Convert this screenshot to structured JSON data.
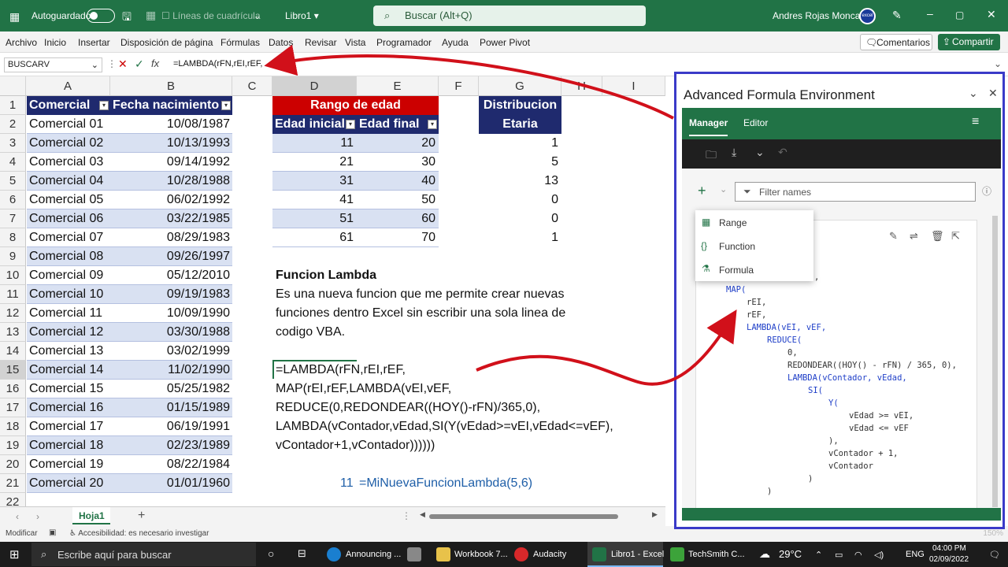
{
  "titlebar": {
    "autosave_label": "Autoguardado",
    "gridlines_label": "Líneas de cuadrícula",
    "filename": "Libro1",
    "search_placeholder": "Buscar (Alt+Q)",
    "user_name": "Andres Rojas Moncada",
    "avatar_text": "excel"
  },
  "menu": {
    "items": [
      "Archivo",
      "Inicio",
      "Insertar",
      "Disposición de página",
      "Fórmulas",
      "Datos",
      "Revisar",
      "Vista",
      "Programador",
      "Ayuda",
      "Power Pivot"
    ],
    "comments": "Comentarios",
    "share": "Compartir"
  },
  "formula_bar": {
    "name_box": "BUSCARV",
    "fx": "fx",
    "formula": "=LAMBDA(rFN,rEI,rEF,"
  },
  "grid": {
    "columns": [
      "A",
      "B",
      "C",
      "D",
      "E",
      "F",
      "G",
      "H",
      "I"
    ],
    "rows": [
      "1",
      "2",
      "3",
      "4",
      "5",
      "6",
      "7",
      "8",
      "9",
      "10",
      "11",
      "12",
      "13",
      "14",
      "15",
      "16",
      "17",
      "18",
      "19",
      "20",
      "21",
      "22"
    ],
    "table1_headers": [
      "Comercial",
      "Fecha nacimiento"
    ],
    "table1": [
      [
        "Comercial 01",
        "10/08/1987"
      ],
      [
        "Comercial 02",
        "10/13/1993"
      ],
      [
        "Comercial 03",
        "09/14/1992"
      ],
      [
        "Comercial 04",
        "10/28/1988"
      ],
      [
        "Comercial 05",
        "06/02/1992"
      ],
      [
        "Comercial 06",
        "03/22/1985"
      ],
      [
        "Comercial 07",
        "08/29/1983"
      ],
      [
        "Comercial 08",
        "09/26/1997"
      ],
      [
        "Comercial 09",
        "05/12/2010"
      ],
      [
        "Comercial 10",
        "09/19/1983"
      ],
      [
        "Comercial 11",
        "10/09/1990"
      ],
      [
        "Comercial 12",
        "03/30/1988"
      ],
      [
        "Comercial 13",
        "03/02/1999"
      ],
      [
        "Comercial 14",
        "11/02/1990"
      ],
      [
        "Comercial 15",
        "05/25/1982"
      ],
      [
        "Comercial 16",
        "01/15/1989"
      ],
      [
        "Comercial 17",
        "06/19/1991"
      ],
      [
        "Comercial 18",
        "02/23/1989"
      ],
      [
        "Comercial 19",
        "08/22/1984"
      ],
      [
        "Comercial 20",
        "01/01/1960"
      ]
    ],
    "range_title": "Rango de edad",
    "range_headers": [
      "Edad inicial",
      "Edad final"
    ],
    "ranges": [
      [
        "11",
        "20"
      ],
      [
        "21",
        "30"
      ],
      [
        "31",
        "40"
      ],
      [
        "41",
        "50"
      ],
      [
        "51",
        "60"
      ],
      [
        "61",
        "70"
      ]
    ],
    "dist_title_1": "Distribucion",
    "dist_title_2": "Etaria",
    "dist_values": [
      "1",
      "5",
      "13",
      "0",
      "0",
      "1"
    ],
    "lambda_title": "Funcion Lambda",
    "lambda_desc": [
      "Es una nueva funcion que me permite crear nuevas",
      "funciones dentro Excel sin escribir una sola linea de",
      "codigo VBA."
    ],
    "formula_lines": [
      "=LAMBDA(rFN,rEI,rEF,",
      "MAP(rEI,rEF,LAMBDA(vEI,vEF,",
      "REDUCE(0,REDONDEAR((HOY()-rFN)/365,0),",
      "LAMBDA(vContador,vEdad,SI(Y(vEdad>=vEI,vEdad<=vEF),",
      "vContador+1,vContador))))))"
    ],
    "result_value": "11",
    "result_formula": "=MiNuevaFuncionLambda(5,6)"
  },
  "sheet_tab": "Hoja1",
  "status": {
    "mode": "Modificar",
    "accessibility": "Accesibilidad: es necesario investigar",
    "zoom": "150%"
  },
  "panel": {
    "title": "Advanced Formula Environment",
    "tabs": [
      "Manager",
      "Editor"
    ],
    "filter_placeholder": "Filter names",
    "dropdown": [
      "Range",
      "Function",
      "Formula"
    ],
    "code_lines": [
      ",",
      "MAP(",
      "rEI,",
      "rEF,",
      "LAMBDA(vEI, vEF,",
      "REDUCE(",
      "0,",
      "REDONDEAR((HOY() - rFN) / 365, 0),",
      "LAMBDA(vContador, vEdad,",
      "SI(",
      "Y(",
      "vEdad >= vEI,",
      "vEdad <= vEF",
      "),",
      "vContador + 1,",
      "vContador",
      ")",
      ")"
    ]
  },
  "taskbar": {
    "search": "Escribe aquí para buscar",
    "apps": [
      "Announcing ...",
      "Workbook 7...",
      "Audacity",
      "Libro1 - Excel",
      "TechSmith C..."
    ],
    "temperature": "29°C",
    "lang": "ENG",
    "time": "04:00 PM",
    "date": "02/09/2022"
  }
}
